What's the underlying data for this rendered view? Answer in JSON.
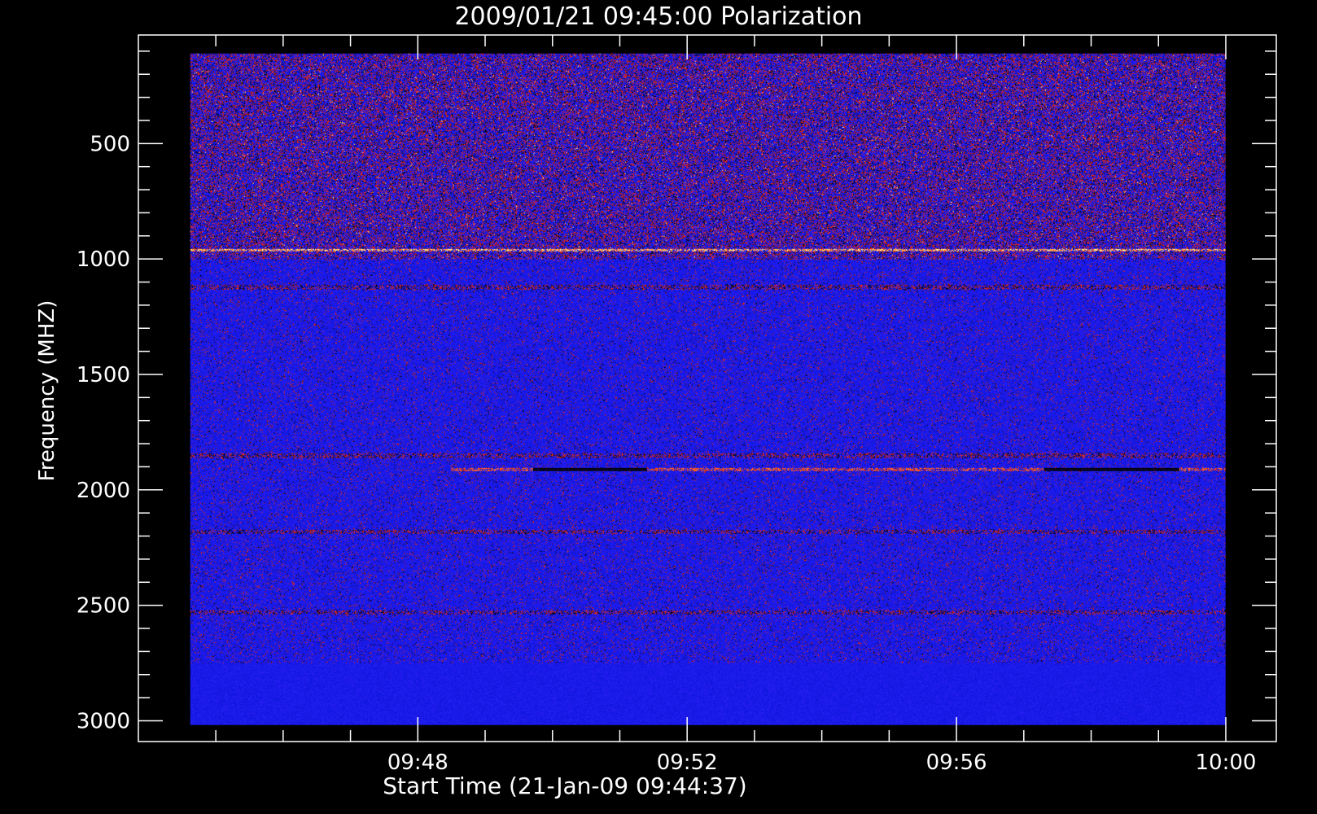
{
  "chart_data": {
    "type": "heatmap",
    "title": "2009/01/21 09:45:00 Polarization",
    "xlabel": "Start Time (21-Jan-09 09:44:37)",
    "ylabel": "Frequency (MHZ)",
    "x_ticks": [
      "09:48",
      "09:52",
      "09:56",
      "10:00"
    ],
    "x_tick_minutes": [
      48,
      52,
      56,
      60
    ],
    "xlim_minutes": [
      44.62,
      60.0
    ],
    "frame_xlim_minutes": [
      43.85,
      60.75
    ],
    "y_ticks": [
      500,
      1000,
      1500,
      2000,
      2500,
      3000
    ],
    "ylim": [
      30,
      3090
    ],
    "data_ylim": [
      110,
      3020
    ],
    "y_inverted": true,
    "colors": {
      "background": "#000000",
      "axis": "#ffffff",
      "base": "#1a1ae8",
      "red": "#d8261a",
      "orange": "#ff6a2a",
      "yellow": "#ffe08a",
      "dark": "#050518"
    },
    "features": [
      {
        "name": "noisy-region",
        "freq_range": [
          110,
          1000
        ],
        "time_range": [
          44.62,
          60.0
        ],
        "intensity": "high"
      },
      {
        "name": "bright-line",
        "freq": 960,
        "time_range": [
          44.62,
          60.0
        ]
      },
      {
        "name": "band",
        "freq": 1120,
        "time_range": [
          44.62,
          60.0
        ]
      },
      {
        "name": "band",
        "freq": 1850,
        "time_range": [
          44.62,
          60.0
        ]
      },
      {
        "name": "band",
        "freq": 1910,
        "time_range": [
          48.5,
          60.0
        ]
      },
      {
        "name": "band",
        "freq": 2180,
        "time_range": [
          44.62,
          60.0
        ]
      },
      {
        "name": "band",
        "freq": 2530,
        "time_range": [
          44.62,
          60.0
        ]
      }
    ]
  }
}
